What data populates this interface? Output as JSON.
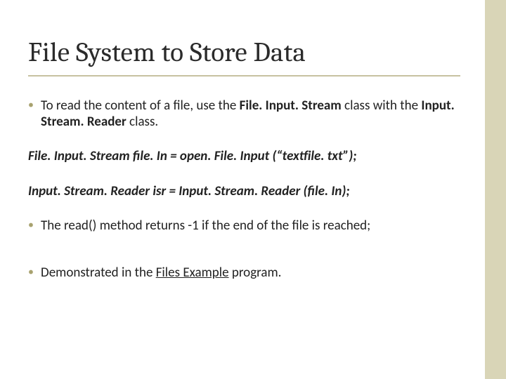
{
  "title": "File System to Store Data",
  "bullets": {
    "b1_pre": "To read the content of a file, use the ",
    "b1_class1": "File. Input. Stream",
    "b1_mid": " class with the ",
    "b1_class2": "Input. Stream. Reader",
    "b1_post": " class.",
    "code1": "File. Input. Stream file. In = open. File. Input (“textfile. txt”);",
    "code2": "Input. Stream. Reader isr = Input. Stream. Reader (file. In);",
    "b2": "The read() method returns -1 if the end of the file is reached;",
    "b3_pre": "Demonstrated in the ",
    "b3_link": "Files Example",
    "b3_post": " program."
  }
}
